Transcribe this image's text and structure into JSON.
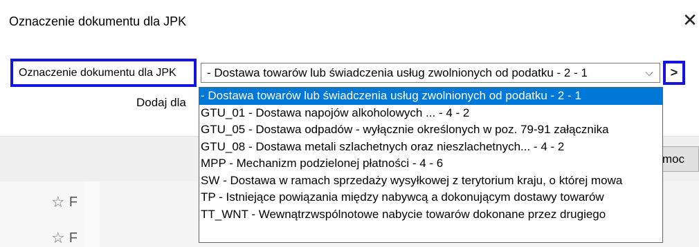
{
  "dialog": {
    "title": "Oznaczenie dokumentu dla JPK",
    "close_glyph": "✕",
    "field_label": "Oznaczenie dokumentu  dla JPK",
    "combo_value": "- Dostawa towarów lub świadczenia usług zwolnionych od podatku - 2 - 1",
    "combo_arrow_glyph": "⌵",
    "next_glyph": ">",
    "add_label": "Dodaj dla",
    "help_button_partial": "moc"
  },
  "dropdown": {
    "options": [
      "- Dostawa towarów lub świadczenia usług zwolnionych od podatku - 2 - 1",
      "GTU_01 - Dostawa napojów alkoholowych ... - 4 - 2",
      "GTU_05 - Dostawa odpadów - wyłącznie określonych w poz. 79-91 załącznika",
      "GTU_08 - Dostawa metali szlachetnych oraz nieszlachetnych... - 4 - 2",
      "MPP - Mechanizm podzielonej płatności - 4 - 6",
      "SW - Dostawa w ramach sprzedaży wysyłkowej z terytorium kraju, o której mowa",
      "TP - Istniejące powiązania między nabywcą a dokonującym dostawy towarów",
      "TT_WNT - Wewnątrzwspólnotowe nabycie towarów dokonane przez drugiego"
    ],
    "selected_index": 0
  },
  "background": {
    "rows": [
      {
        "icon": "star-icon",
        "glyph": "☆",
        "text": "F"
      },
      {
        "icon": "star-icon",
        "glyph": "☆",
        "text": "F"
      }
    ]
  },
  "colors": {
    "highlight_border": "#1414e0",
    "selected_bg": "#0078d7"
  }
}
